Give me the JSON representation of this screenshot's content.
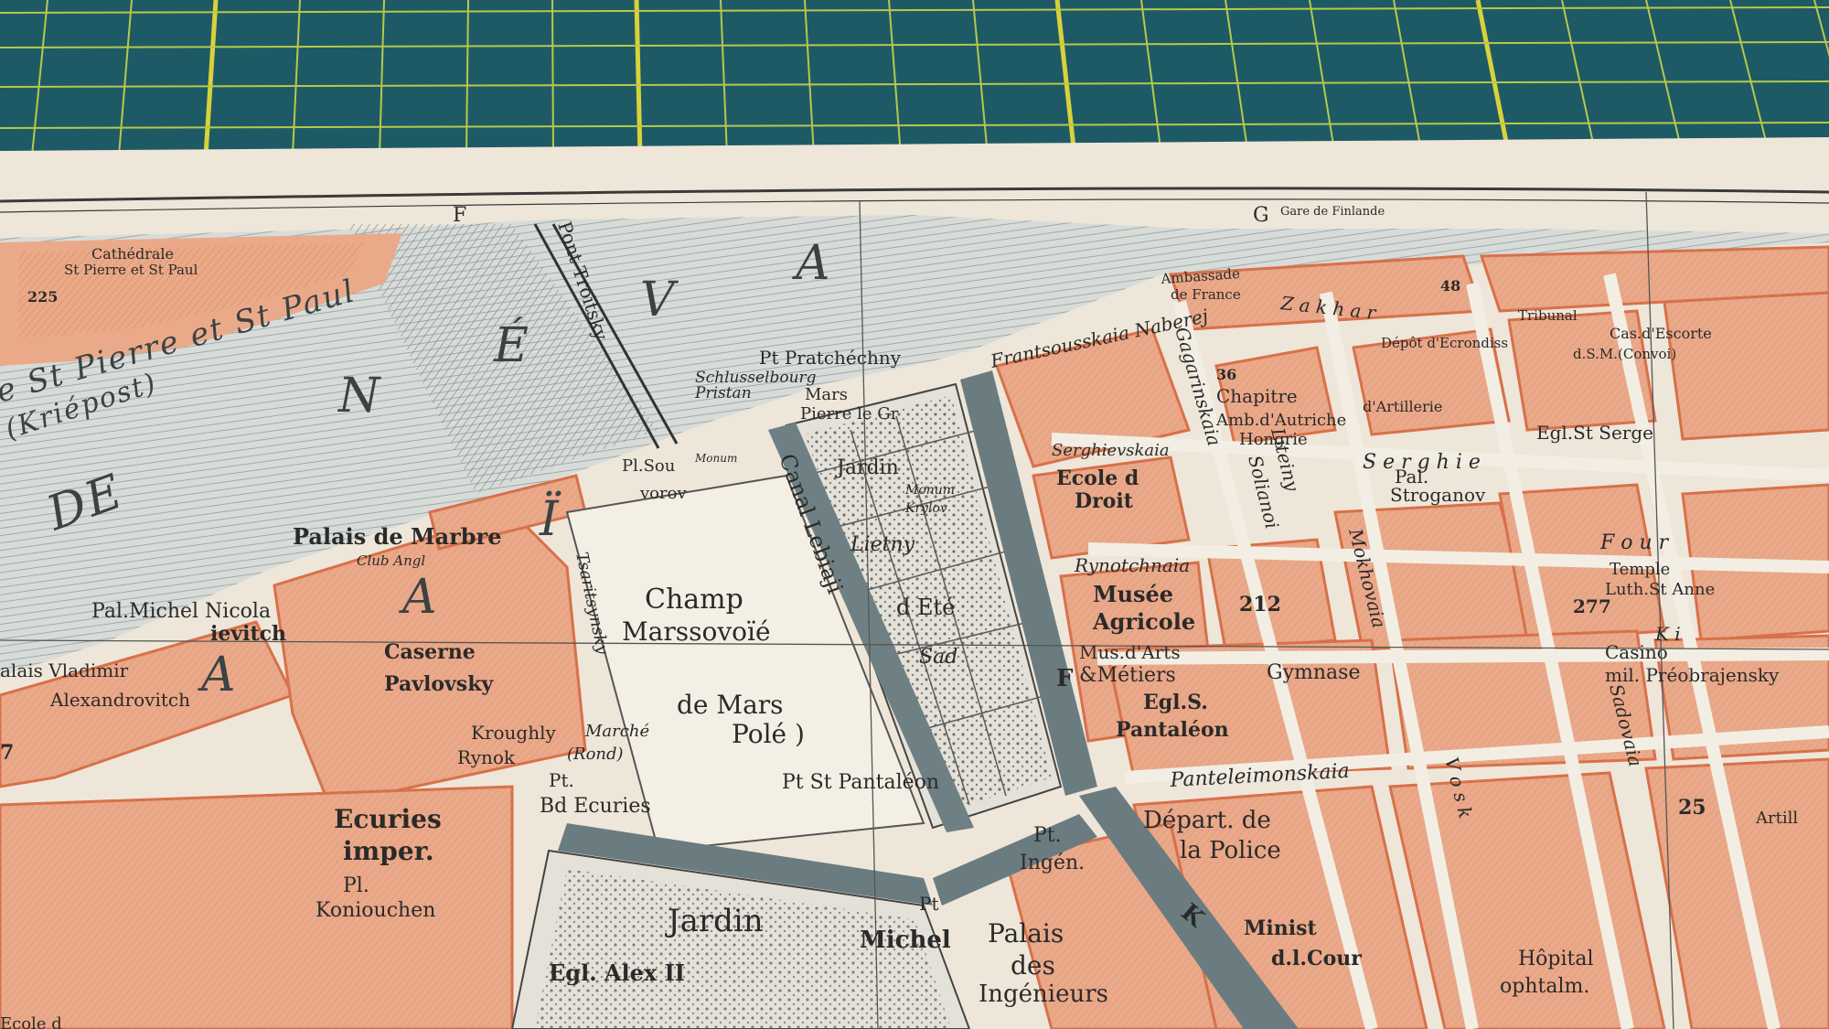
{
  "mat": {
    "color": "#1e5a66",
    "grid_color": "#b6c94a",
    "major_line_color": "#d8d23a"
  },
  "paper": {
    "color": "#eee6d8",
    "block_color": "#e9a98a",
    "building_color": "#d8704a",
    "water_color": "#cfd3d0",
    "canal_color": "#6b7c80"
  },
  "border_letters": {
    "f": "F",
    "g": "G"
  },
  "water_labels": {
    "neva_n": "N",
    "neva_e": "É",
    "neva_v": "V",
    "neva_a": "A",
    "naia_n": "N",
    "naia_a": "A",
    "naia_i": "Ï",
    "naia_a2": "A",
    "de": "DE",
    "st_pierre": "e St Pierre et St Paul",
    "kriepost": "(Kriépost)"
  },
  "labels": {
    "cathedrale": "Cathédrale",
    "st_pierre_paul": "St Pierre et St Paul",
    "num_225": "225",
    "pont_troitsky": "Pont Troïtsky",
    "pt_pratcheechny": "Pt Pratchéchny",
    "schusselburg": "Schlusselbourg",
    "pristan": "Pristan",
    "mars": "Mars",
    "pierre_le_gr": "Pierre le Gr",
    "pl_souvorov": "Pl.Sou",
    "vorov": "vorov",
    "monum": "Monum",
    "palais_marbre": "Palais de Marbre",
    "club_angl": "Club Angl",
    "pal_michel": "Pal.Michel Nicola",
    "ievitch": "ievitch",
    "palais_vladimir": "alais Vladimir",
    "alexandrovitch": "Alexandrovitch",
    "caserne": "Caserne",
    "pavlovsky": "Pavlovsky",
    "tsaritsinsky": "Tsaritsynsky",
    "champ": "Champ",
    "marssovoie": "Marssovoïé",
    "de_mars": "de Mars",
    "pole": "Polé )",
    "kroughly": "Kroughly",
    "marche": "Marché",
    "rynok": "Rynok",
    "rond": "(Rond)",
    "pt_bd_ecuries": "Pt.",
    "bd_ecuries": "Bd Ecuries",
    "pt_st_pantaleon": "Pt St Pantaléon",
    "jardin_ete": "Jardin",
    "monum_krylov": "Monum",
    "krylov": "Krylov",
    "lietny": "Lietny",
    "d_ete": "d Eté",
    "sad": "Sad",
    "canal_lebiaji": "Canal Lebiaji",
    "frantsousskaia": "Frantsousskaia Naberej",
    "ambassade": "Ambassade",
    "de_france": "de France",
    "gare_de_finlande": "Gare de Finlande",
    "chapitre": "Chapitre",
    "amb_autriche": "Amb.d'Autriche",
    "hongrie": "Hongrie",
    "artillerie": "d'Artillerie",
    "depot": "Dépôt d'Ecrondiss",
    "eglise_st_serge": "Egl.St Serge",
    "serghievskaia": "Serghievskaia",
    "ecole_droit": "Ecole d",
    "droit": "Droit",
    "pal_stroganov": "Pal.",
    "stroganov": "Stroganov",
    "rynotchnaia": "Rynotchnaia",
    "musee": "Musée",
    "agricole": "Agricole",
    "num_212": "212",
    "mus_arts": "Mus.d'Arts",
    "metiers": "&Métiers",
    "gymnase": "Gymnase",
    "egl_s": "Egl.S.",
    "pantaleon": "Pantaléon",
    "panteleimonskaia": "Panteleimonskaia",
    "fourschtatskaia": "F o u r",
    "temple": "Temple",
    "luth_st_anne": "Luth.St Anne",
    "num_277": "277",
    "casino": "Casino",
    "preobrajensky": "mil. Préobrajensky",
    "num_25": "25",
    "depart_police": "Départ. de",
    "la_police": "la Police",
    "ministere": "Minist",
    "d_la_cour": "d.l.Cour",
    "hopital": "Hôpital",
    "ophtalm": "ophtalm.",
    "ecuries_imper": "Ecuries",
    "imper": "imper.",
    "pl_koniouchen": "Pl.",
    "koniouchen": "Koniouchen",
    "jardin_michel": "Jardin",
    "michel": "Michel",
    "palais_ingenieurs": "Palais",
    "des": "des",
    "ingenieurs": "Ingénieurs",
    "pt_ingen": "Pt.",
    "ingen": "Ingén.",
    "pt_michel": "Pt",
    "egl_alex": "Egl. Alex II",
    "num_36": "36",
    "num_48": "48",
    "tribunal": "Tribunal",
    "cas_escorte": "Cas.d'Escorte",
    "ssm_convoi": "d.S.M.(Convoi)",
    "sergievskaia_street": "S e r g h i e",
    "zakharievskaia": "Z a k h a r",
    "gagarinskaia": "Gagarinskaia",
    "liteiny": "Liteiny",
    "kirotchnaia": "K i",
    "voskresensky": "V o s k",
    "mokhovaia": "Mokhovaia",
    "solianoi": "Solianoi",
    "fontanka": "F",
    "canal_k": "K",
    "sadovaia": "Sadovaia",
    "num_7": "7",
    "ecole_d": "Ecole d",
    "artill": "Artill"
  }
}
